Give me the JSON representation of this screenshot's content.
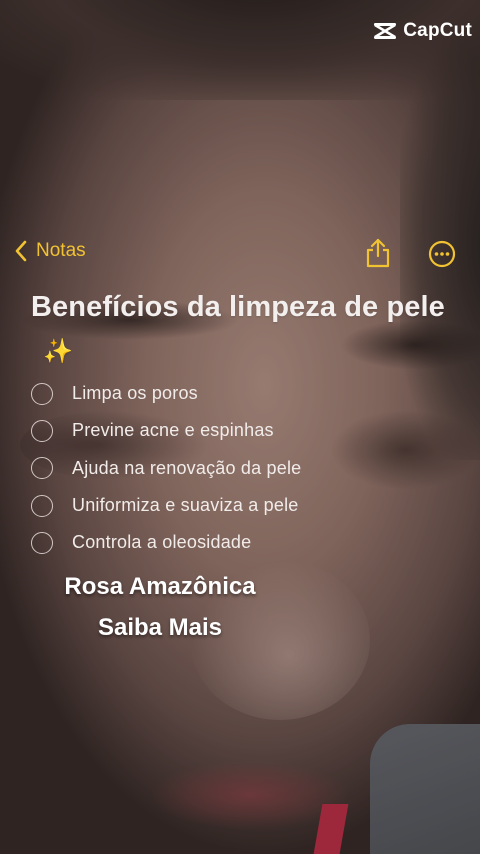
{
  "watermark": {
    "brand": "CapCut",
    "icon": "capcut-logo-icon"
  },
  "header": {
    "back_label": "Notas",
    "back_icon": "chevron-left-icon",
    "share_icon": "share-icon",
    "more_icon": "ellipsis-circle-icon",
    "accent_color": "#f1c232"
  },
  "note": {
    "title": "Benefícios da limpeza de pele",
    "title_emoji": "✨",
    "checklist": [
      {
        "label": "Limpa os poros",
        "checked": false
      },
      {
        "label": "Previne acne e espinhas",
        "checked": false
      },
      {
        "label": "Ajuda na renovação da pele",
        "checked": false
      },
      {
        "label": "Uniformiza e suaviza a pele",
        "checked": false
      },
      {
        "label": "Controla a oleosidade",
        "checked": false
      }
    ]
  },
  "overlay_text": {
    "line1": "Rosa Amazônica",
    "line2": "Saiba Mais"
  }
}
